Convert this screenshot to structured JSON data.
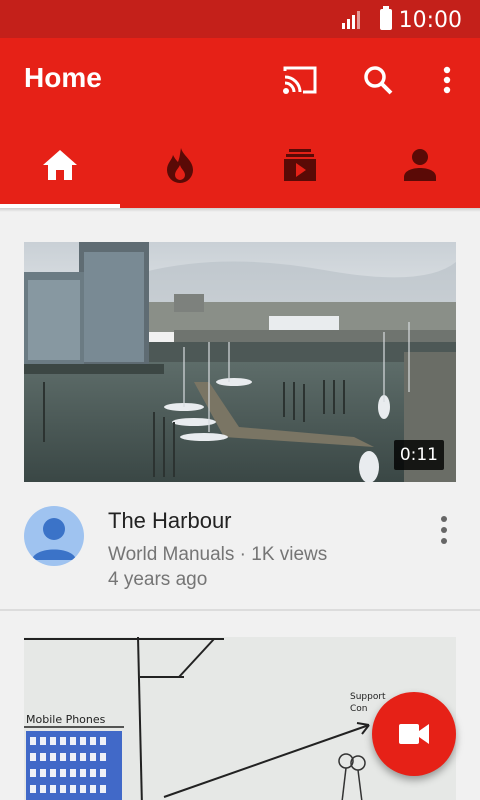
{
  "status_bar": {
    "time": "10:00"
  },
  "app_bar": {
    "title": "Home"
  },
  "tabs": [
    {
      "icon": "home-icon",
      "active": true
    },
    {
      "icon": "trending-icon",
      "active": false
    },
    {
      "icon": "subscriptions-icon",
      "active": false
    },
    {
      "icon": "account-icon",
      "active": false
    }
  ],
  "feed": {
    "videos": [
      {
        "title": "The Harbour",
        "channel_views": "World Manuals · 1K views",
        "age": "4 years ago",
        "duration": "0:11"
      },
      {
        "thumbnail_text": {
          "label_left": "Mobile Phones",
          "label_right": "Support Con"
        }
      }
    ]
  },
  "colors": {
    "status_bar": "#c4201a",
    "accent": "#e62117",
    "background": "#f1f1f1"
  }
}
